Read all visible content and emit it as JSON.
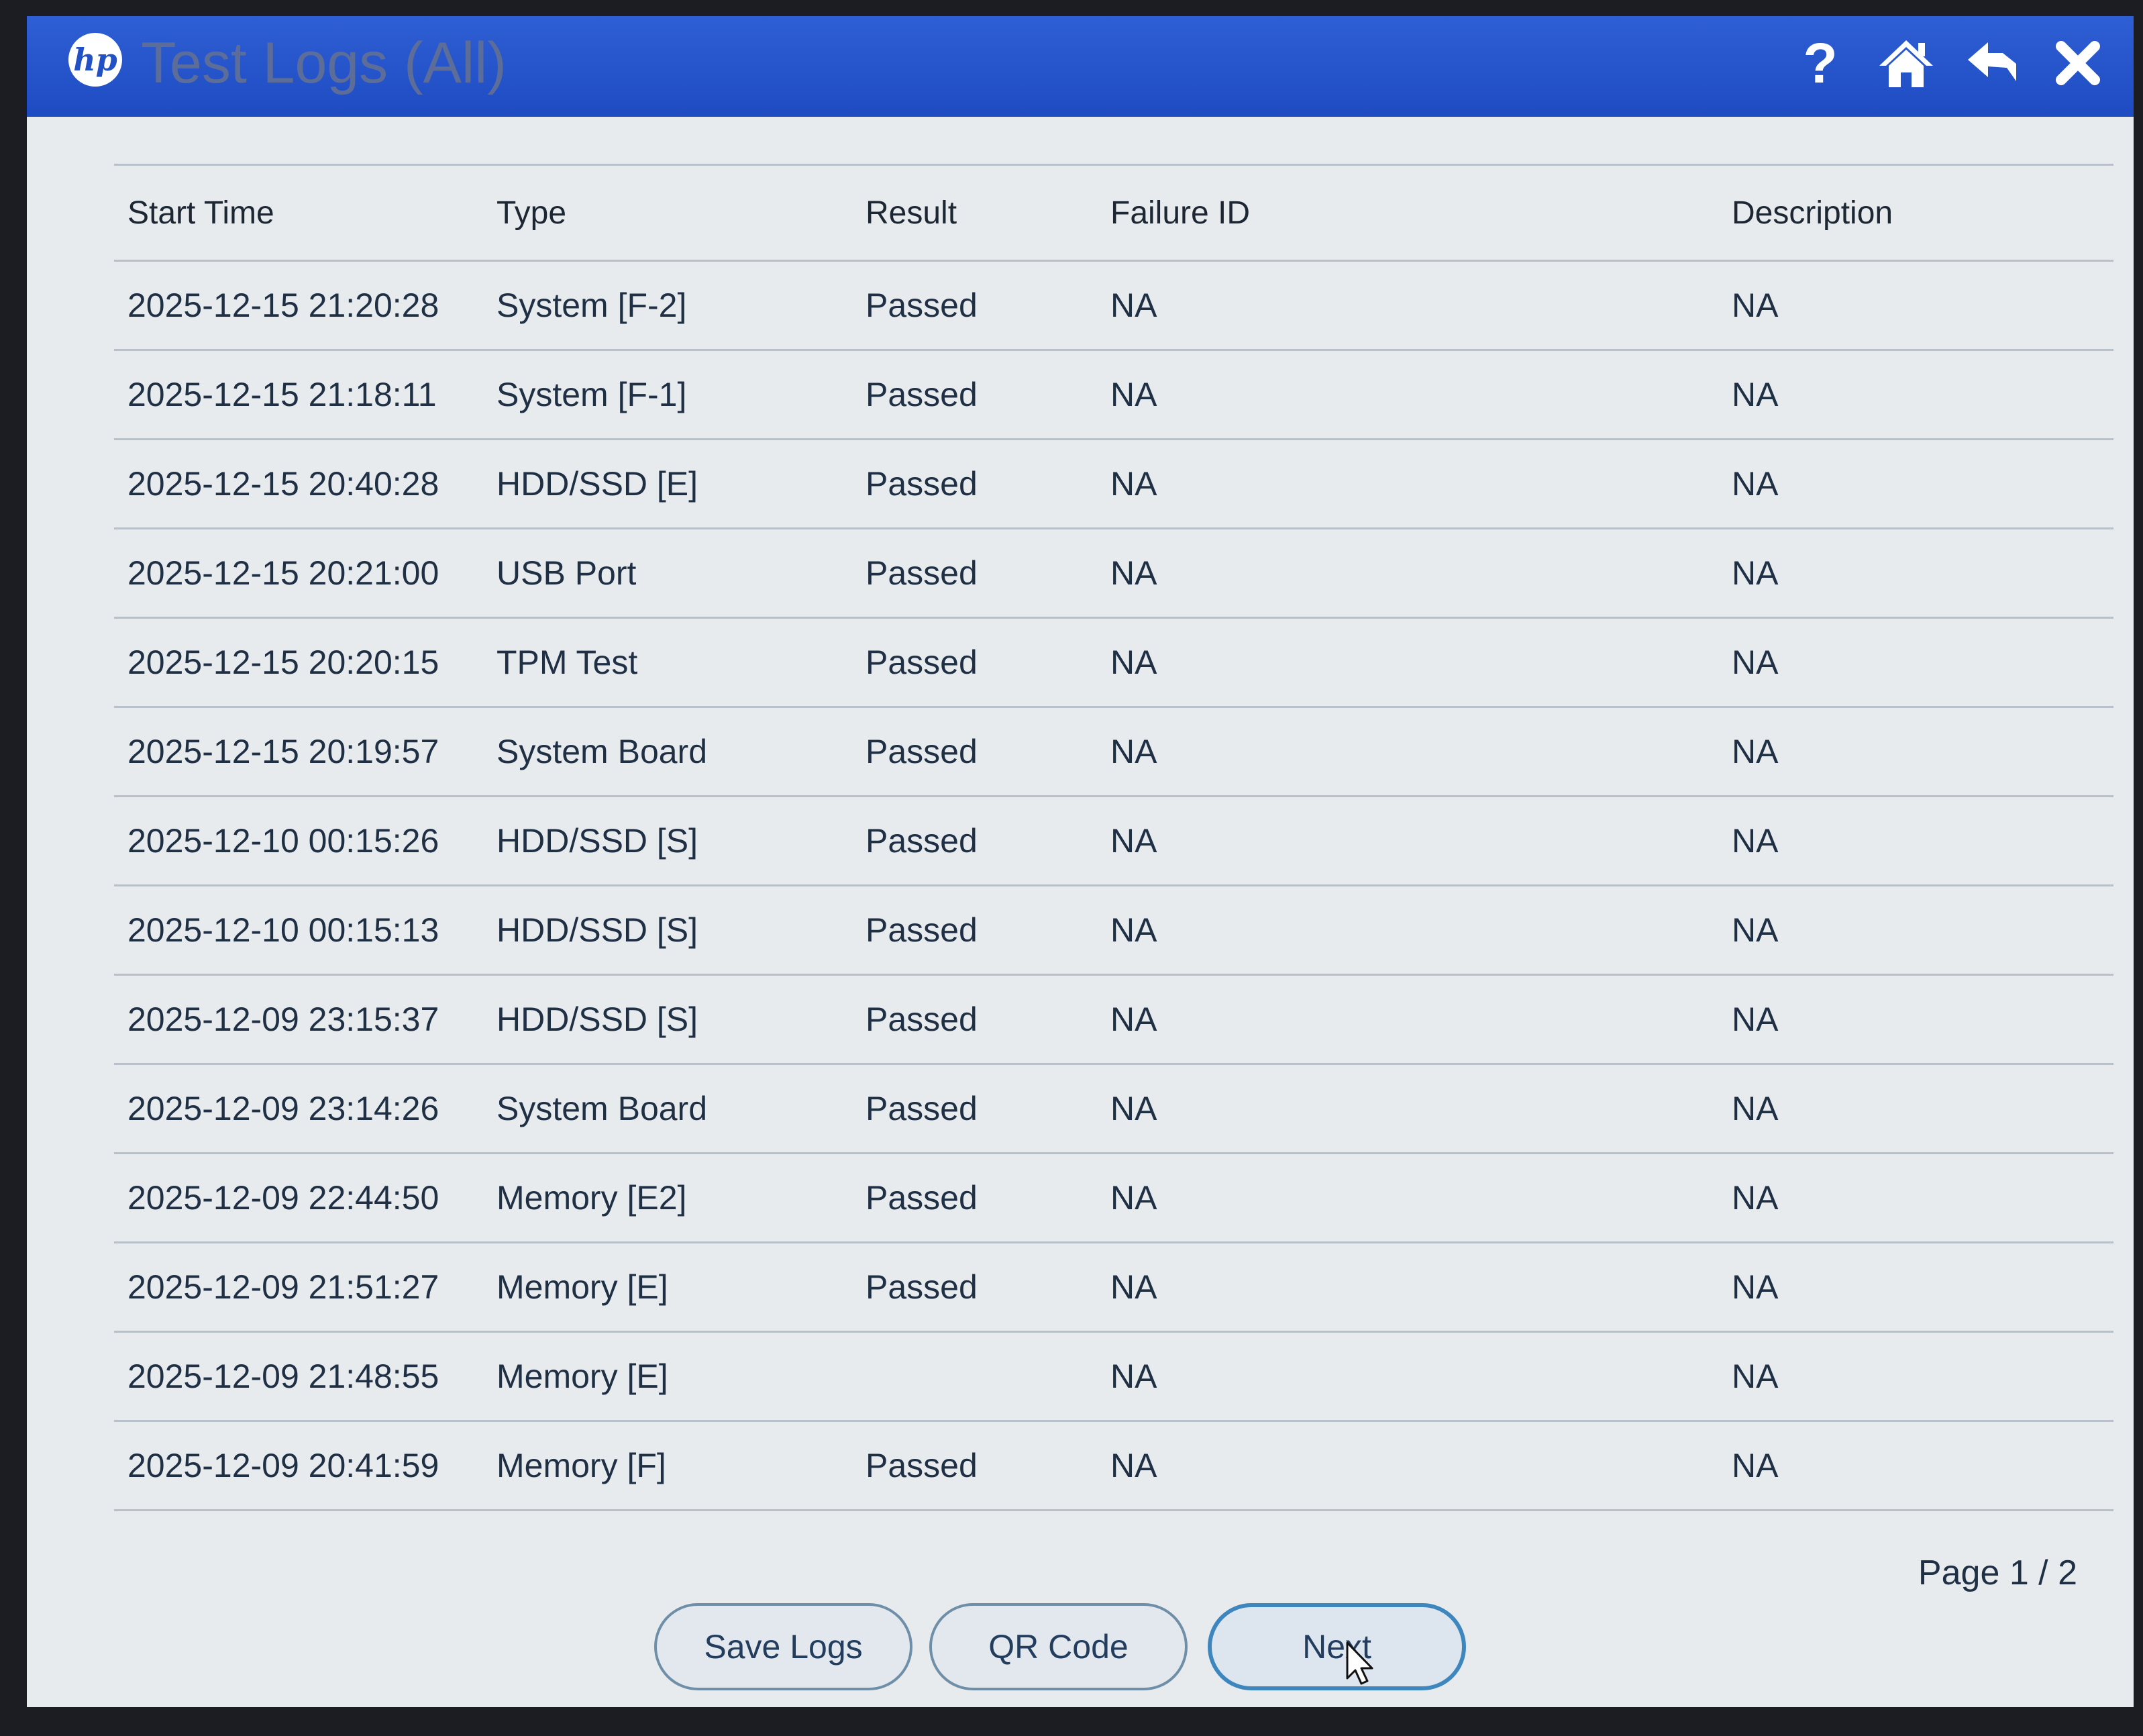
{
  "window": {
    "logo": "hp",
    "title": "Test Logs (All)",
    "icons": [
      "help-icon",
      "home-icon",
      "back-icon",
      "close-icon"
    ],
    "help_glyph": "?"
  },
  "colors": {
    "title_bar": "#2456cc",
    "background": "#e8ebee",
    "text": "#1f2f44",
    "button_border": "#6e8fa7",
    "active_button_border": "#3d87be"
  },
  "table": {
    "columns": [
      "Start Time",
      "Type",
      "Result",
      "Failure ID",
      "Description"
    ],
    "rows": [
      {
        "start_time": "2025-12-15 21:20:28",
        "type": "System  [F-2]",
        "result": "Passed",
        "failure_id": "NA",
        "description": "NA"
      },
      {
        "start_time": "2025-12-15 21:18:11",
        "type": "System  [F-1]",
        "result": "Passed",
        "failure_id": "NA",
        "description": "NA"
      },
      {
        "start_time": "2025-12-15 20:40:28",
        "type": "HDD/SSD [E]",
        "result": "Passed",
        "failure_id": "NA",
        "description": "NA"
      },
      {
        "start_time": "2025-12-15 20:21:00",
        "type": "USB Port",
        "result": "Passed",
        "failure_id": "NA",
        "description": "NA"
      },
      {
        "start_time": "2025-12-15 20:20:15",
        "type": "TPM Test",
        "result": "Passed",
        "failure_id": "NA",
        "description": "NA"
      },
      {
        "start_time": "2025-12-15 20:19:57",
        "type": "System Board",
        "result": "Passed",
        "failure_id": "NA",
        "description": "NA"
      },
      {
        "start_time": "2025-12-10 00:15:26",
        "type": "HDD/SSD [S]",
        "result": "Passed",
        "failure_id": "NA",
        "description": "NA"
      },
      {
        "start_time": "2025-12-10 00:15:13",
        "type": "HDD/SSD [S]",
        "result": "Passed",
        "failure_id": "NA",
        "description": "NA"
      },
      {
        "start_time": "2025-12-09 23:15:37",
        "type": "HDD/SSD [S]",
        "result": "Passed",
        "failure_id": "NA",
        "description": "NA"
      },
      {
        "start_time": "2025-12-09 23:14:26",
        "type": "System Board",
        "result": "Passed",
        "failure_id": "NA",
        "description": "NA"
      },
      {
        "start_time": "2025-12-09 22:44:50",
        "type": "Memory [E2]",
        "result": "Passed",
        "failure_id": "NA",
        "description": "NA"
      },
      {
        "start_time": "2025-12-09 21:51:27",
        "type": "Memory [E]",
        "result": "Passed",
        "failure_id": "NA",
        "description": "NA"
      },
      {
        "start_time": "2025-12-09 21:48:55",
        "type": "Memory [E]",
        "result": "",
        "failure_id": "NA",
        "description": "NA"
      },
      {
        "start_time": "2025-12-09 20:41:59",
        "type": "Memory [F]",
        "result": "Passed",
        "failure_id": "NA",
        "description": "NA"
      }
    ]
  },
  "footer": {
    "page_indicator": "Page 1 / 2",
    "buttons": {
      "save_logs": "Save Logs",
      "qr_code": "QR Code",
      "next": "Next"
    }
  }
}
